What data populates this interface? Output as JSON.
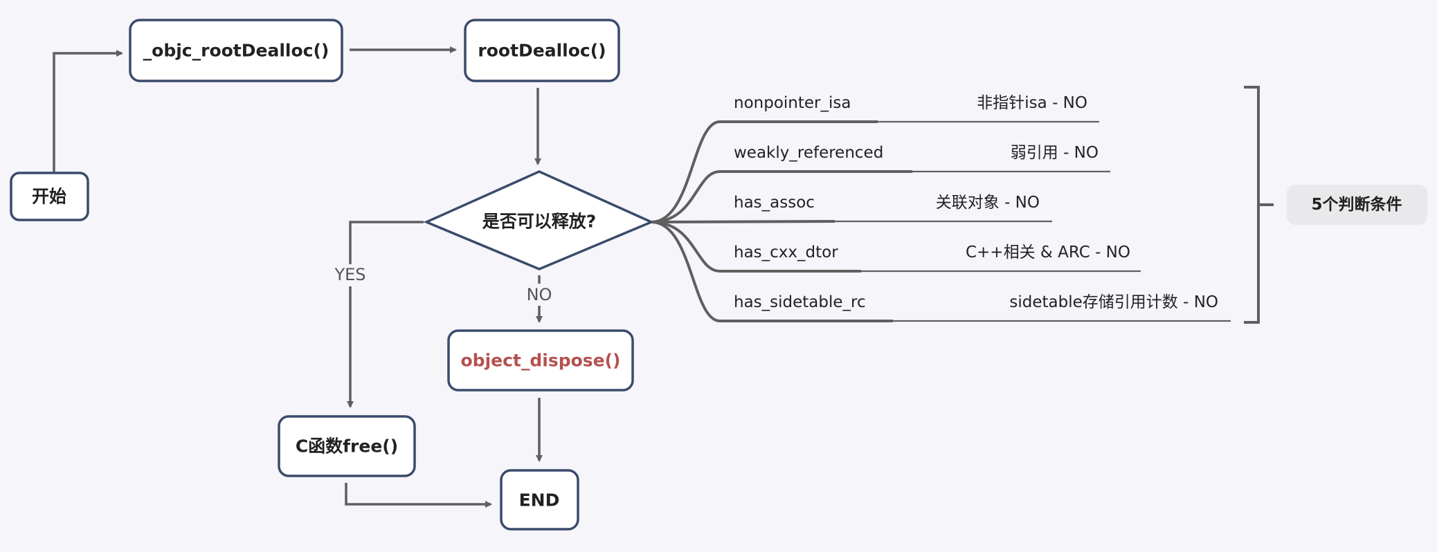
{
  "nodes": {
    "start": "开始",
    "objc_root_dealloc": "_objc_rootDealloc()",
    "root_dealloc": "rootDealloc()",
    "decision": "是否可以释放?",
    "object_dispose": "object_dispose()",
    "c_free": "C函数free()",
    "end": "END"
  },
  "edge_labels": {
    "yes": "YES",
    "no": "NO"
  },
  "conditions": [
    {
      "flag": "nonpointer_isa",
      "value": "非指针isa - NO"
    },
    {
      "flag": "weakly_referenced",
      "value": "弱引用 - NO"
    },
    {
      "flag": "has_assoc",
      "value": "关联对象 - NO"
    },
    {
      "flag": "has_cxx_dtor",
      "value": "C++相关 & ARC - NO"
    },
    {
      "flag": "has_sidetable_rc",
      "value": "sidetable存储引用计数 - NO"
    }
  ],
  "summary": "5个判断条件",
  "colors": {
    "background": "#f5f5fa",
    "node_border": "#3b4a6b",
    "connector": "#5f5f5f",
    "highlight_text": "#b5514f",
    "summary_bg": "#e9e9eb"
  }
}
